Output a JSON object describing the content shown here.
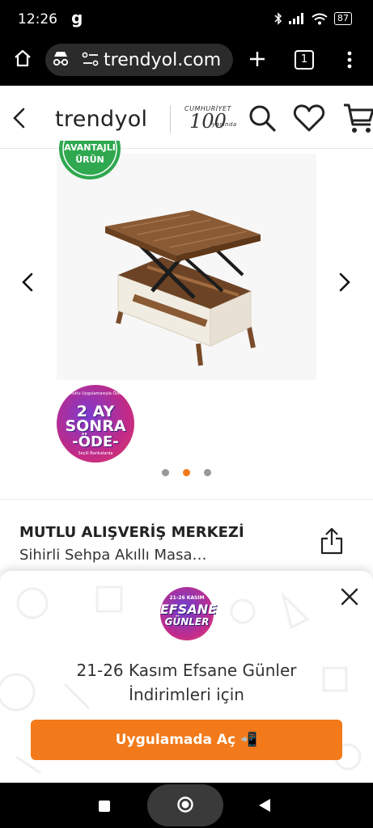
{
  "status_bar": {
    "time": "12:26",
    "carrier_glyph": "g",
    "battery": "87",
    "icons": [
      "bluetooth-icon",
      "signal-icon",
      "wifi-icon",
      "battery-icon"
    ]
  },
  "browser": {
    "url": "trendyol.com",
    "tab_count": "1",
    "icons": [
      "home-icon",
      "incognito-icon",
      "site-settings-icon",
      "new-tab-icon",
      "tabs-icon",
      "more-icon"
    ]
  },
  "header": {
    "logo": "trendyol",
    "cumhuriyet_line1": "CUMHURİYET",
    "cumhuriyet_line2": "100",
    "cumhuriyet_line3": "yaşında"
  },
  "gallery": {
    "badge_avantaj_line1": "AVANTAJLI",
    "badge_avantaj_line2": "ÜRÜN",
    "badge_2ay_small": "Mutlu Uygulamasıyla Özel",
    "badge_2ay_main": "2 AY SONRA",
    "badge_2ay_ode": "-ÖDE-",
    "badge_2ay_foot": "Seçili Bankalarda",
    "dots_total": 3,
    "dots_active_index": 1
  },
  "product": {
    "brand": "MUTLU ALIŞVERİŞ MERKEZİ",
    "name": "Sihirli Sehpa Akıllı Masa…"
  },
  "popup": {
    "campaign_top": "21-26 KASIM",
    "campaign_mid": "EFSANE",
    "campaign_bot": "GÜNLER",
    "text_line1": "21-26 Kasım Efsane Günler",
    "text_line2": "İndirimleri için",
    "cta": "Uygulamada Aç 📲"
  },
  "colors": {
    "accent": "#f27a1a",
    "badge_green": "#2fa84f",
    "badge_purple": "#7b3bd0",
    "wood": "#8a5a34",
    "cream": "#f1ece1"
  }
}
